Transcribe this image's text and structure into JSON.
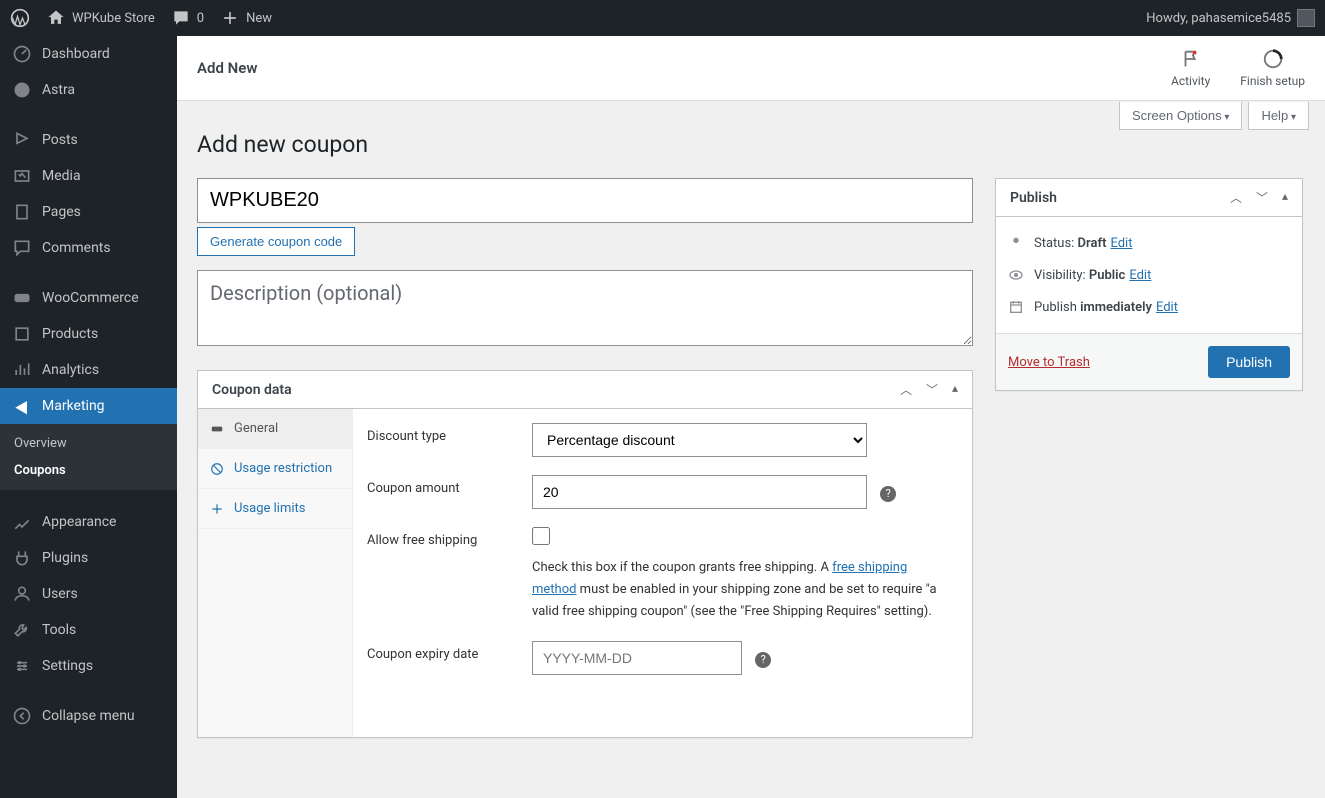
{
  "adminbar": {
    "site_name": "WPKube Store",
    "comments_count": "0",
    "new_label": "New",
    "howdy": "Howdy, pahasemice5485"
  },
  "sidebar": {
    "items": [
      {
        "label": "Dashboard"
      },
      {
        "label": "Astra"
      },
      {
        "label": "Posts"
      },
      {
        "label": "Media"
      },
      {
        "label": "Pages"
      },
      {
        "label": "Comments"
      },
      {
        "label": "WooCommerce"
      },
      {
        "label": "Products"
      },
      {
        "label": "Analytics"
      },
      {
        "label": "Marketing"
      },
      {
        "label": "Appearance"
      },
      {
        "label": "Plugins"
      },
      {
        "label": "Users"
      },
      {
        "label": "Tools"
      },
      {
        "label": "Settings"
      },
      {
        "label": "Collapse menu"
      }
    ],
    "submenu": {
      "overview": "Overview",
      "coupons": "Coupons"
    }
  },
  "header": {
    "title": "Add New",
    "activity": "Activity",
    "finish": "Finish setup",
    "screen_options": "Screen Options",
    "help": "Help"
  },
  "page": {
    "heading": "Add new coupon",
    "title_value": "WPKUBE20",
    "generate_btn": "Generate coupon code",
    "desc_placeholder": "Description (optional)"
  },
  "coupon": {
    "panel_title": "Coupon data",
    "tabs": {
      "general": "General",
      "usage_restriction": "Usage restriction",
      "usage_limits": "Usage limits"
    },
    "fields": {
      "discount_type_label": "Discount type",
      "discount_type_value": "Percentage discount",
      "amount_label": "Coupon amount",
      "amount_value": "20",
      "free_shipping_label": "Allow free shipping",
      "free_shipping_desc1": "Check this box if the coupon grants free shipping. A ",
      "free_shipping_link": "free shipping method",
      "free_shipping_desc2": " must be enabled in your shipping zone and be set to require \"a valid free shipping coupon\" (see the \"Free Shipping Requires\" setting).",
      "expiry_label": "Coupon expiry date",
      "expiry_placeholder": "YYYY-MM-DD"
    }
  },
  "publish": {
    "title": "Publish",
    "status_label": "Status: ",
    "status_value": "Draft",
    "visibility_label": "Visibility: ",
    "visibility_value": "Public",
    "schedule_label": "Publish ",
    "schedule_value": "immediately",
    "edit": "Edit",
    "trash": "Move to Trash",
    "button": "Publish"
  }
}
